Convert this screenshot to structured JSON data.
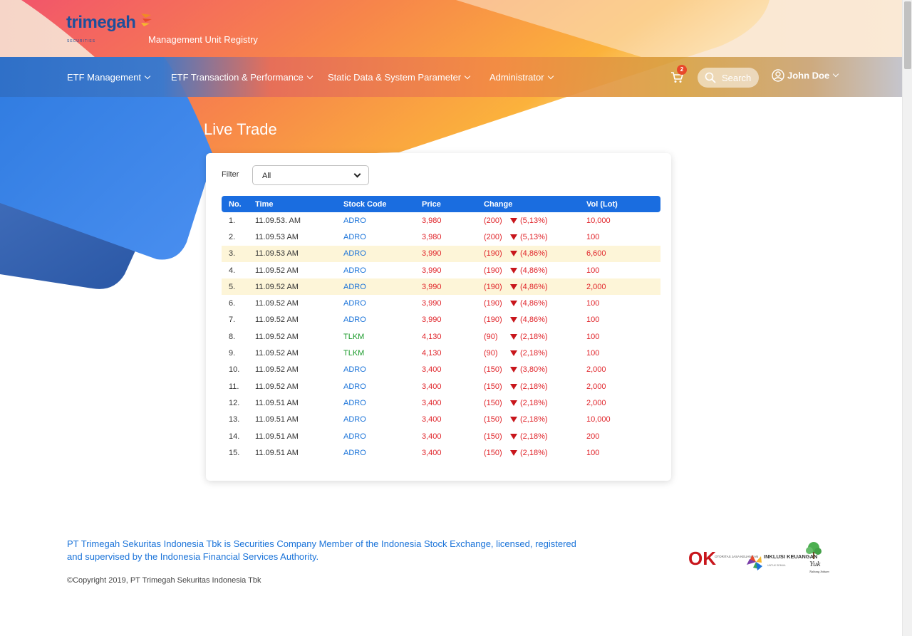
{
  "header": {
    "brand": "trimegah",
    "brand_sub": "SECURITIES",
    "app_name": "Management Unit Registry"
  },
  "nav": {
    "items": [
      {
        "label": "ETF Management"
      },
      {
        "label": "ETF Transaction & Performance"
      },
      {
        "label": "Static Data & System Parameter"
      },
      {
        "label": "Administrator"
      }
    ],
    "cart_count": "2",
    "search_placeholder": "Search",
    "user_name": "John Doe"
  },
  "page": {
    "title": "Live Trade"
  },
  "filter": {
    "label": "Filter",
    "value": "All"
  },
  "table": {
    "headers": [
      "No.",
      "Time",
      "Stock Code",
      "Price",
      "Change",
      "Vol (Lot)"
    ],
    "rows": [
      {
        "no": "1.",
        "time": "11.09.53. AM",
        "code": "ADRO",
        "price": "3,980",
        "change": "(200)",
        "pct": "(5,13%)",
        "vol": "10,000",
        "highlight": false,
        "code_color": "blue"
      },
      {
        "no": "2.",
        "time": "11.09.53 AM",
        "code": "ADRO",
        "price": "3,980",
        "change": "(200)",
        "pct": "(5,13%)",
        "vol": "100",
        "highlight": false,
        "code_color": "blue"
      },
      {
        "no": "3.",
        "time": "11.09.53 AM",
        "code": "ADRO",
        "price": "3,990",
        "change": "(190)",
        "pct": "(4,86%)",
        "vol": "6,600",
        "highlight": true,
        "code_color": "blue"
      },
      {
        "no": "4.",
        "time": "11.09.52 AM",
        "code": "ADRO",
        "price": "3,990",
        "change": "(190)",
        "pct": "(4,86%)",
        "vol": "100",
        "highlight": false,
        "code_color": "blue"
      },
      {
        "no": "5.",
        "time": "11.09.52 AM",
        "code": "ADRO",
        "price": "3,990",
        "change": "(190)",
        "pct": "(4,86%)",
        "vol": "2,000",
        "highlight": true,
        "code_color": "blue"
      },
      {
        "no": "6.",
        "time": "11.09.52 AM",
        "code": "ADRO",
        "price": "3,990",
        "change": "(190)",
        "pct": "(4,86%)",
        "vol": "100",
        "highlight": false,
        "code_color": "blue"
      },
      {
        "no": "7.",
        "time": "11.09.52 AM",
        "code": "ADRO",
        "price": "3,990",
        "change": "(190)",
        "pct": "(4,86%)",
        "vol": "100",
        "highlight": false,
        "code_color": "blue"
      },
      {
        "no": "8.",
        "time": "11.09.52 AM",
        "code": "TLKM",
        "price": "4,130",
        "change": "(90)",
        "pct": "(2,18%)",
        "vol": "100",
        "highlight": false,
        "code_color": "green"
      },
      {
        "no": "9.",
        "time": "11.09.52 AM",
        "code": "TLKM",
        "price": "4,130",
        "change": "(90)",
        "pct": "(2,18%)",
        "vol": "100",
        "highlight": false,
        "code_color": "green"
      },
      {
        "no": "10.",
        "time": "11.09.52 AM",
        "code": "ADRO",
        "price": "3,400",
        "change": "(150)",
        "pct": "(3,80%)",
        "vol": "2,000",
        "highlight": false,
        "code_color": "blue"
      },
      {
        "no": "11.",
        "time": "11.09.52 AM",
        "code": "ADRO",
        "price": "3,400",
        "change": "(150)",
        "pct": "(2,18%)",
        "vol": "2,000",
        "highlight": false,
        "code_color": "blue"
      },
      {
        "no": "12.",
        "time": "11.09.51 AM",
        "code": "ADRO",
        "price": "3,400",
        "change": "(150)",
        "pct": "(2,18%)",
        "vol": "2,000",
        "highlight": false,
        "code_color": "blue"
      },
      {
        "no": "13.",
        "time": "11.09.51 AM",
        "code": "ADRO",
        "price": "3,400",
        "change": "(150)",
        "pct": "(2,18%)",
        "vol": "10,000",
        "highlight": false,
        "code_color": "blue"
      },
      {
        "no": "14.",
        "time": "11.09.51 AM",
        "code": "ADRO",
        "price": "3,400",
        "change": "(150)",
        "pct": "(2,18%)",
        "vol": "200",
        "highlight": false,
        "code_color": "blue"
      },
      {
        "no": "15.",
        "time": "11.09.51 AM",
        "code": "ADRO",
        "price": "3,400",
        "change": "(150)",
        "pct": "(2,18%)",
        "vol": "100",
        "highlight": false,
        "code_color": "blue"
      }
    ]
  },
  "footer": {
    "disclaimer": "PT Trimegah Sekuritas Indonesia Tbk is Securities Company Member of the Indonesia Stock Exchange, licensed, registered and supervised by the Indonesia Financial Services Authority.",
    "copyright": "©Copyright 2019, PT Trimegah Sekuritas Indonesia Tbk",
    "partner_logos": [
      {
        "name": "OJK",
        "text": "OK",
        "sub": "OTORITAS JASA KEUANGAN"
      },
      {
        "name": "Inklusi Keuangan",
        "text": "INKLUSI KEUANGAN",
        "sub": "UNTUK SEMUA"
      },
      {
        "name": "Yuk Nabung Saham",
        "text": "Yuk",
        "sub": "Nabung Saham"
      }
    ]
  },
  "colors": {
    "table_header": "#1a6de0",
    "row_highlight": "#fdf5d8",
    "negative": "#e0242a",
    "code_blue": "#1a73d9",
    "code_green": "#1a9a2a",
    "brand": "#1e4f9b"
  }
}
